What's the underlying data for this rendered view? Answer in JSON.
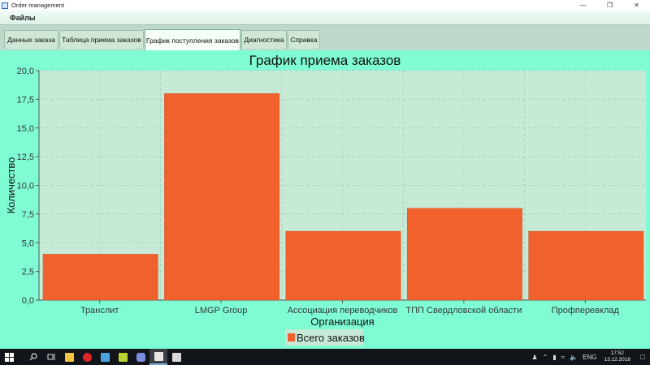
{
  "window": {
    "title": "Order management"
  },
  "menu": {
    "files": "Файлы"
  },
  "tabs": [
    {
      "label": "Данные заказа"
    },
    {
      "label": "Таблица приема заказов"
    },
    {
      "label": "График поступления заказов"
    },
    {
      "label": "Диагностика"
    },
    {
      "label": "Справка"
    }
  ],
  "active_tab_index": 2,
  "chart_data": {
    "type": "bar",
    "title": "График приема заказов",
    "xlabel": "Организация",
    "ylabel": "Количество",
    "categories": [
      "Транслит",
      "LMGP Group",
      "Ассоциация переводчиков",
      "ТПП Свердловской области",
      "Профперевклад"
    ],
    "series": [
      {
        "name": "Всего заказов",
        "values": [
          4,
          18,
          6,
          8,
          6
        ],
        "color": "#f0612d"
      }
    ],
    "ylim": [
      0,
      20
    ],
    "yticks": [
      "0,0",
      "2,5",
      "5,0",
      "7,5",
      "10,0",
      "12,5",
      "15,0",
      "17,5",
      "20,0"
    ],
    "grid": true,
    "legend": "bottom",
    "plot_bg": "#c6ead6",
    "bar_color": "#f0612d"
  },
  "taskbar": {
    "lang": "ENG",
    "time": "17:52",
    "date": "13.12.2018"
  }
}
